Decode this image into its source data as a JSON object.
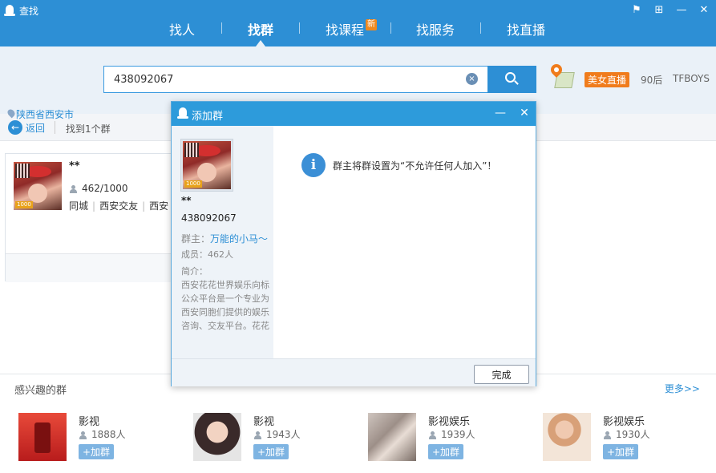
{
  "window": {
    "title": "查找",
    "controls": {
      "feedback": "⚑",
      "skin": "⊞",
      "minimize": "—",
      "close": "✕"
    }
  },
  "nav": {
    "tabs": [
      {
        "label": "找人"
      },
      {
        "label": "找群"
      },
      {
        "label": "找课程",
        "badge": "新"
      },
      {
        "label": "找服务"
      },
      {
        "label": "找直播"
      }
    ],
    "active_tab": "找群"
  },
  "search": {
    "value": "438092067",
    "clear_glyph": "×",
    "hot_tag": "美女直播",
    "links": [
      "90后",
      "TFBOYS"
    ]
  },
  "results": {
    "back_label": "返回",
    "found_text": "找到1个群",
    "card": {
      "name": "**",
      "members": "462/1000",
      "tags": [
        "同城",
        "西安交友",
        "西安"
      ],
      "location": "陕西省西安市",
      "avatar_badge": "1000"
    }
  },
  "interest": {
    "title": "感兴趣的群",
    "more": "更多>>",
    "items": [
      {
        "name": "影视",
        "count": "1888人",
        "join": "+加群"
      },
      {
        "name": "影视",
        "count": "1943人",
        "join": "+加群"
      },
      {
        "name": "影视娱乐",
        "count": "1939人",
        "join": "+加群"
      },
      {
        "name": "影视娱乐",
        "count": "1930人",
        "join": "+加群"
      }
    ]
  },
  "dialog": {
    "title": "添加群",
    "min_glyph": "—",
    "close_glyph": "✕",
    "group_name": "**",
    "group_id": "438092067",
    "owner_label": "群主：",
    "owner": "万能的小马～",
    "members": "成员：462人",
    "intro_label": "简介：",
    "intro": "西安花花世界娱乐向标公众平台是一个专业为西安同胞们提供的娱乐咨询、交友平台。花花",
    "info_glyph": "i",
    "message": "群主将群设置为“不允许任何人加入”！",
    "done": "完成",
    "avatar_badge": "1000"
  }
}
